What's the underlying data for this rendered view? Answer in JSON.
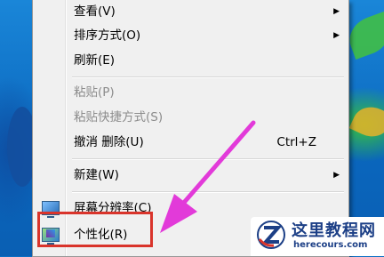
{
  "context_menu": {
    "items": [
      {
        "label": "查看(V)",
        "submenu": true
      },
      {
        "label": "排序方式(O)",
        "submenu": true
      },
      {
        "label": "刷新(E)"
      },
      {
        "label": "粘贴(P)",
        "disabled": true
      },
      {
        "label": "粘贴快捷方式(S)",
        "disabled": true
      },
      {
        "label": "撤消 删除(U)",
        "shortcut": "Ctrl+Z"
      },
      {
        "label": "新建(W)",
        "submenu": true
      },
      {
        "label": "屏幕分辨率(C)",
        "icon": "screen-resolution-icon"
      },
      {
        "label": "个性化(R)",
        "icon": "personalize-icon"
      }
    ]
  },
  "annotation": {
    "highlight_color": "#d9342b",
    "arrow_color": "#e23ad9",
    "target": "个性化(R)"
  },
  "watermark": {
    "title": "这里教程网",
    "url": "herecours.com"
  }
}
